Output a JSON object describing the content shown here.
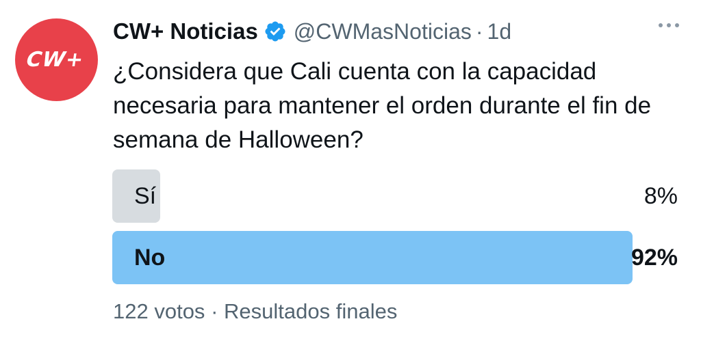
{
  "author": {
    "avatar_text": "CW+",
    "avatar_color": "#e8414a",
    "display_name": "CW+ Noticias",
    "handle": "@CWMasNoticias",
    "separator": "·",
    "time": "1d",
    "verified_icon": "verified-badge-icon",
    "verified_color": "#1d9bf0"
  },
  "tweet": {
    "text": "¿Considera que Cali cuenta con la capacidad necesaria para mantener el orden durante el fin de semana de Halloween?"
  },
  "poll": {
    "options": [
      {
        "label": "Sí",
        "percent_text": "8%",
        "percent": 8,
        "winner": false,
        "fill_color": "#d7dce0"
      },
      {
        "label": "No",
        "percent_text": "92%",
        "percent": 92,
        "winner": true,
        "fill_color": "#7cc3f5"
      }
    ],
    "votes": "122 votos",
    "separator": "·",
    "status": "Resultados finales"
  },
  "more_icon": "more-options-icon"
}
